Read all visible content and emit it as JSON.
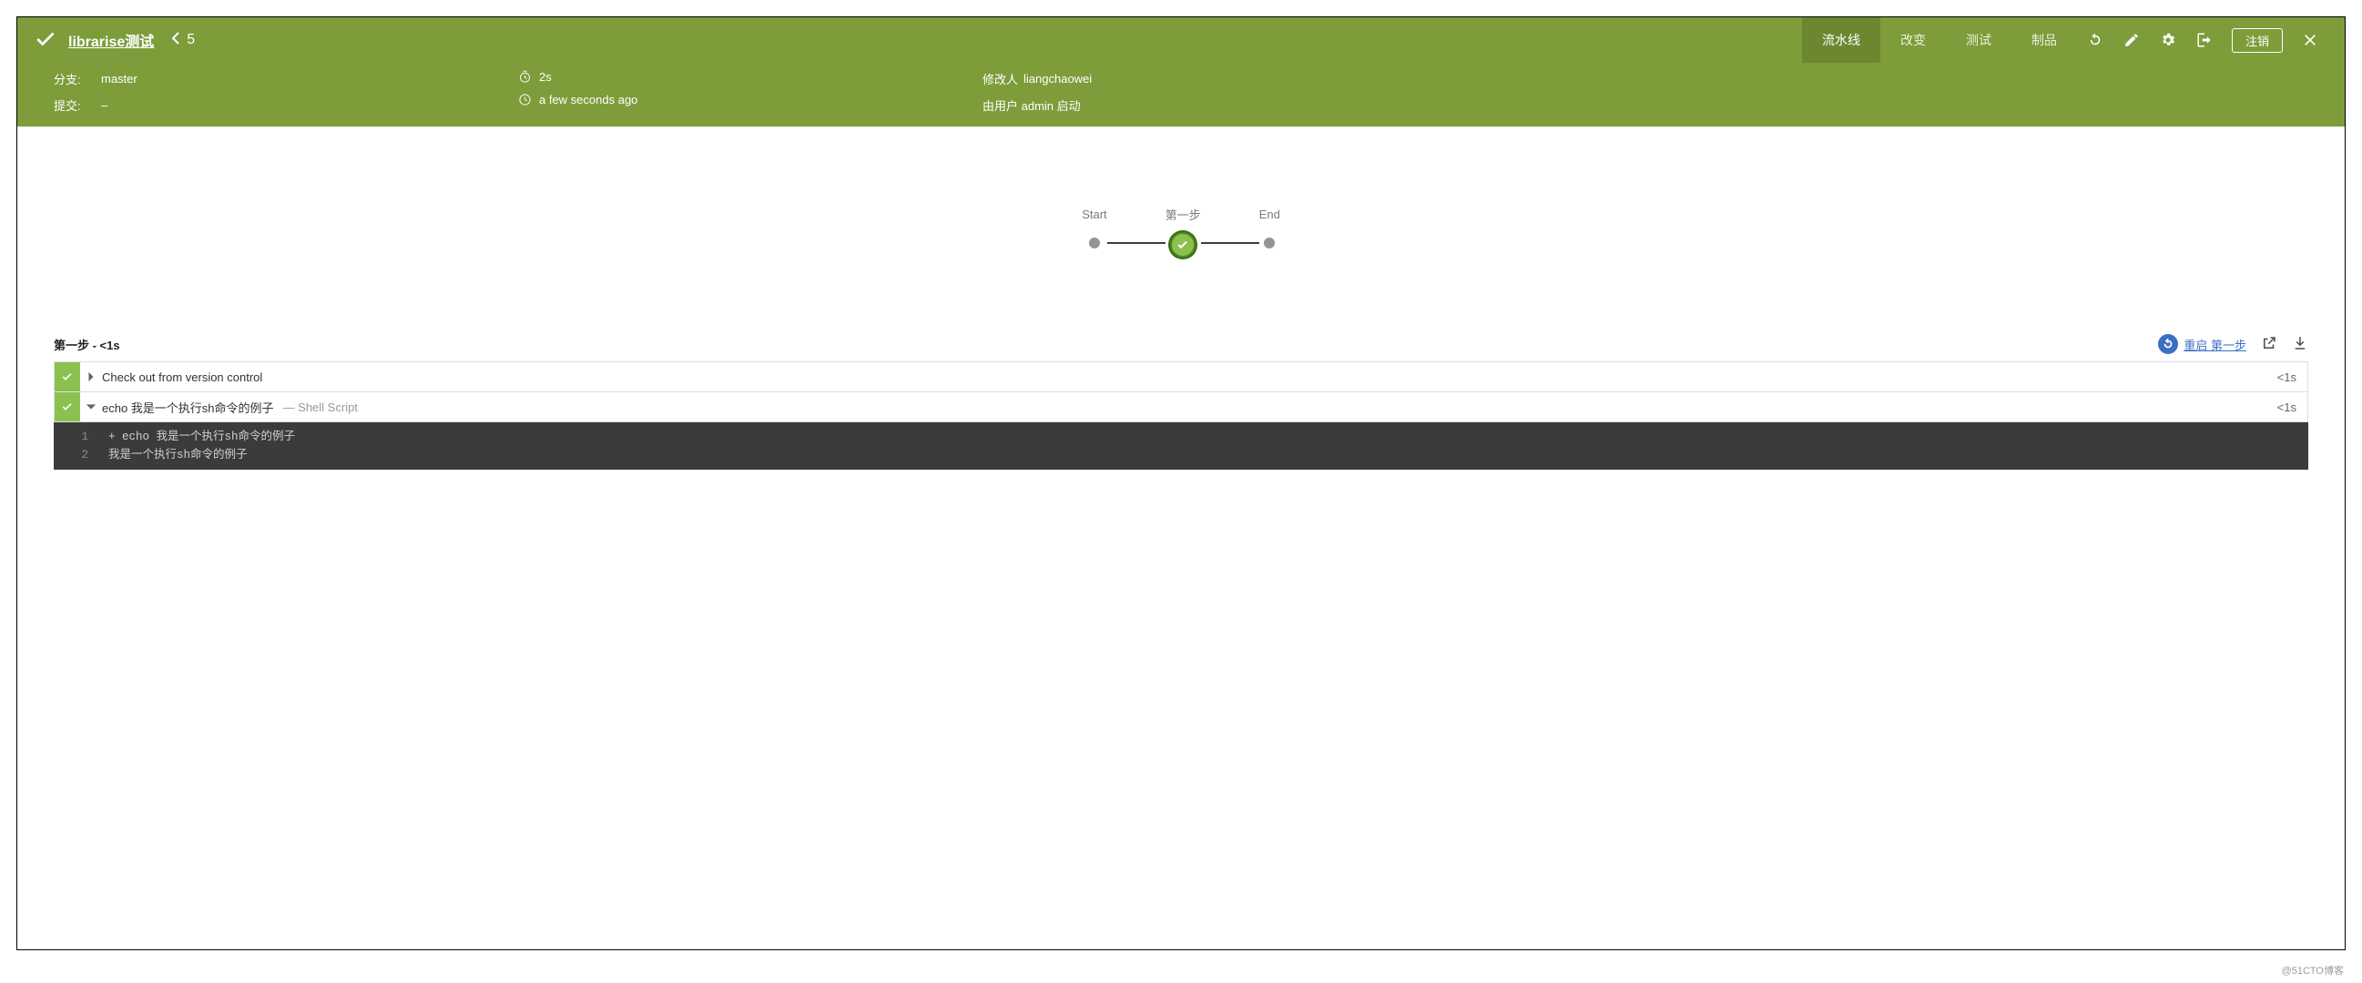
{
  "header": {
    "project_name": "librarise测试",
    "build_number": "5",
    "tabs": {
      "pipeline": "流水线",
      "changes": "改变",
      "tests": "测试",
      "artifacts": "制品"
    },
    "logout": "注销"
  },
  "subheader": {
    "branch_label": "分支:",
    "branch_value": "master",
    "commit_label": "提交:",
    "commit_value": "–",
    "duration_value": "2s",
    "time_value": "a few seconds ago",
    "author_label": "修改人",
    "author_value": "liangchaowei",
    "trigger_text": "由用户 admin 启动"
  },
  "pipeline": {
    "start": "Start",
    "stage1": "第一步",
    "end": "End"
  },
  "stage": {
    "title": "第一步 - <1s",
    "restart": "重启 第一步"
  },
  "steps": [
    {
      "name": "Check out from version control",
      "desc": "",
      "duration": "<1s",
      "expanded": false
    },
    {
      "name": "echo 我是一个执行sh命令的例子",
      "desc": "— Shell Script",
      "duration": "<1s",
      "expanded": true
    }
  ],
  "console": {
    "lines": [
      {
        "n": "1",
        "text": "+ echo 我是一个执行sh命令的例子"
      },
      {
        "n": "2",
        "text": "我是一个执行sh命令的例子"
      }
    ]
  },
  "watermark": "@51CTO博客"
}
